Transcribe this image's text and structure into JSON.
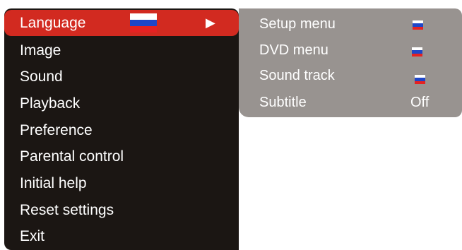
{
  "main_menu": {
    "items": [
      {
        "label": "Language",
        "selected": true,
        "arrow": "▶",
        "flag": "russia-flag-icon"
      },
      {
        "label": "Image"
      },
      {
        "label": "Sound"
      },
      {
        "label": "Playback"
      },
      {
        "label": "Preference"
      },
      {
        "label": "Parental control"
      },
      {
        "label": "Initial help"
      },
      {
        "label": "Reset settings"
      },
      {
        "label": "Exit"
      }
    ]
  },
  "sub_menu": {
    "items": [
      {
        "label": "Setup menu",
        "value_icon": "russia-flag-icon"
      },
      {
        "label": "DVD menu",
        "value_icon": "russia-flag-icon"
      },
      {
        "label": "Sound track",
        "value_icon": "russia-flag-icon"
      },
      {
        "label": "Subtitle",
        "value": "Off"
      }
    ]
  },
  "colors": {
    "main_bg": "#1b1613",
    "selected_bg": "#d22a20",
    "sub_bg": "#989390",
    "text": "#ffffff"
  }
}
